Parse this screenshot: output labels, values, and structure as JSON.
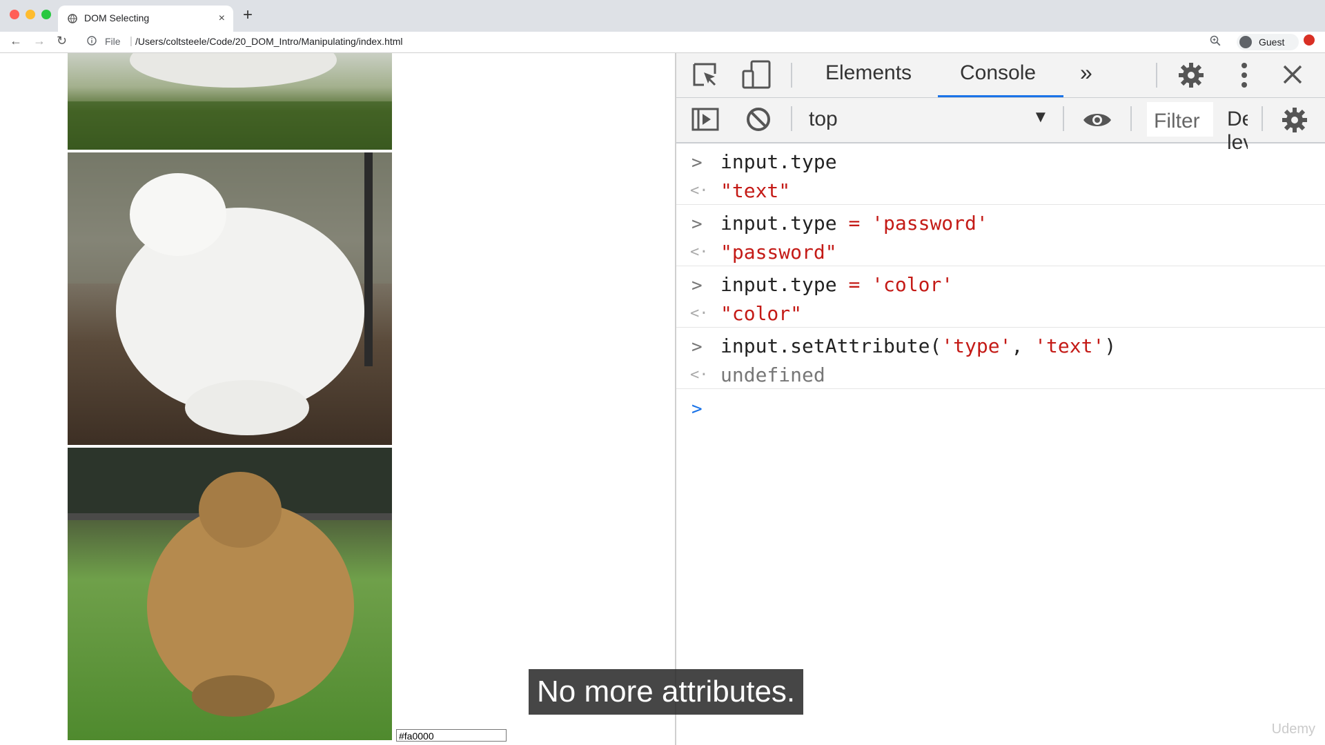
{
  "browser": {
    "tab_title": "DOM Selecting",
    "tab_close": "×",
    "new_tab": "+",
    "nav_back": "←",
    "nav_forward": "→",
    "nav_reload": "↻",
    "file_label": "File",
    "address_separator": "|",
    "url": "/Users/coltsteele/Code/20_DOM_Intro/Manipulating/index.html",
    "profile_name": "Guest"
  },
  "page": {
    "color_input_value": "#fa0000"
  },
  "devtools": {
    "tabs": [
      {
        "label": "Elements",
        "active": false
      },
      {
        "label": "Console",
        "active": true
      }
    ],
    "more_tabs": "»",
    "context": "top",
    "context_arrow": "▼",
    "filter_placeholder": "Filter",
    "levels_label": "Default levels",
    "active_prompt": ">",
    "entries": [
      {
        "input_plain": "input.type",
        "input_op": "",
        "input_str": "",
        "input_tail": "",
        "output": "\"text\"",
        "output_kind": "string"
      },
      {
        "input_plain": "input.type ",
        "input_op": "= ",
        "input_str": "'password'",
        "input_tail": "",
        "output": "\"password\"",
        "output_kind": "string"
      },
      {
        "input_plain": "input.type ",
        "input_op": "= ",
        "input_str": "'color'",
        "input_tail": "",
        "output": "\"color\"",
        "output_kind": "string"
      },
      {
        "input_plain": "input.setAttribute(",
        "input_op": "",
        "input_str": "'type'",
        "input_tail": ", ",
        "input_str2": "'text'",
        "input_end": ")",
        "output": "undefined",
        "output_kind": "undefined"
      }
    ]
  },
  "caption": "No more attributes.",
  "watermark": "Udemy",
  "colors": {
    "tab_active_underline": "#1a73e8",
    "string_red": "#c41a16",
    "prompt_blue": "#1a73e8"
  }
}
